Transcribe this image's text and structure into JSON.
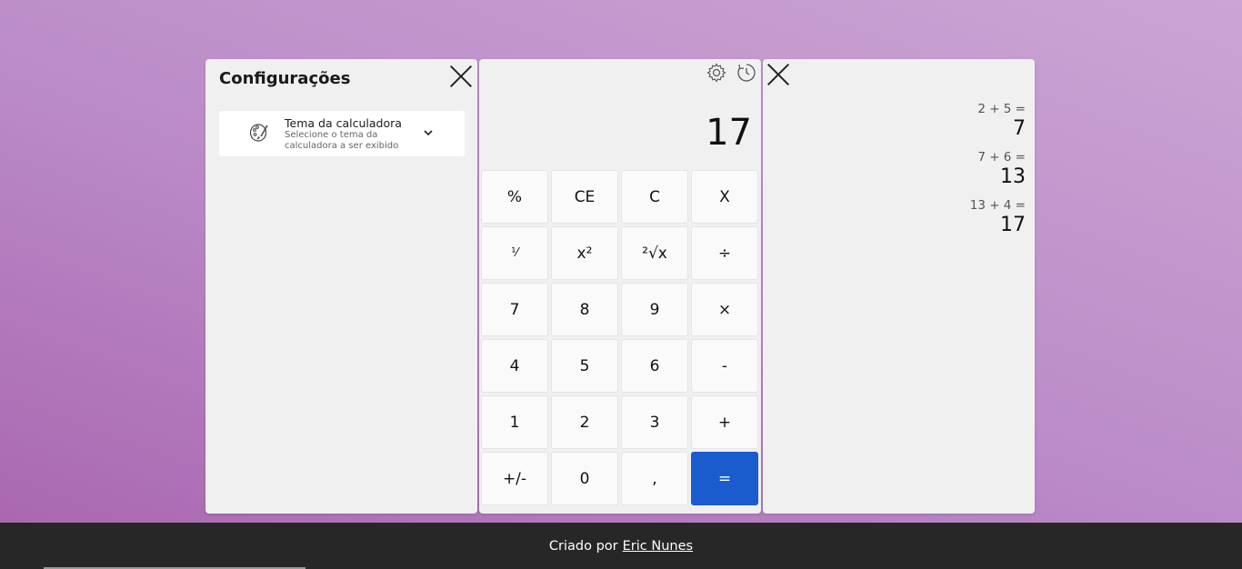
{
  "settings": {
    "title": "Configurações",
    "theme": {
      "name": "Tema da calculadora",
      "description": "Selecione o tema da calculadora a ser exibido"
    }
  },
  "calculator": {
    "display": "17",
    "keys": [
      [
        "%",
        "CE",
        "C",
        "X"
      ],
      [
        "¹⁄",
        "x²",
        "²√x",
        "÷"
      ],
      [
        "7",
        "8",
        "9",
        "×"
      ],
      [
        "4",
        "5",
        "6",
        "-"
      ],
      [
        "1",
        "2",
        "3",
        "+"
      ],
      [
        "+/-",
        "0",
        ",",
        "="
      ]
    ]
  },
  "history": {
    "entries": [
      {
        "expression": "2 + 5 =",
        "result": "7"
      },
      {
        "expression": "7 + 6 =",
        "result": "13"
      },
      {
        "expression": "13 + 4 =",
        "result": "17"
      }
    ]
  },
  "footer": {
    "prefix": "Criado por",
    "author": "Eric Nunes"
  },
  "colors": {
    "accent": "#1a5bcd",
    "footer_bg": "#272727"
  },
  "icons": {
    "settings": "gear-icon",
    "history": "history-icon",
    "theme": "palette-icon",
    "expand": "chevron-down-icon",
    "close": "close-icon"
  }
}
